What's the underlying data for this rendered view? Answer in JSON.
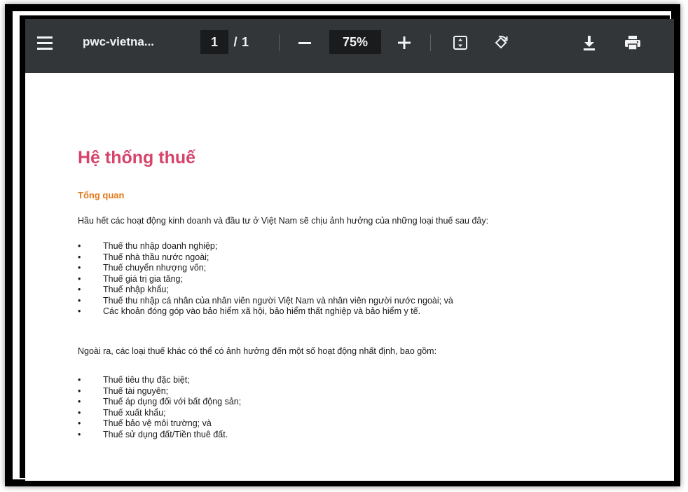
{
  "toolbar": {
    "file_name": "pwc-vietna...",
    "page_current": "1",
    "page_separator": "/",
    "page_total": "1",
    "zoom": "75%",
    "icons": [
      "menu-icon",
      "zoom-out-icon",
      "zoom-in-icon",
      "fit-page-icon",
      "rotate-icon",
      "download-icon",
      "print-icon"
    ]
  },
  "document": {
    "title": "Hệ thống thuế",
    "subtitle": "Tổng quan",
    "intro": "Hầu hết các hoạt động kinh doanh và đầu tư ở Việt Nam sẽ chịu ảnh hưởng của những loại thuế sau đây:",
    "main_taxes": [
      "Thuế thu nhập doanh nghiệp;",
      "Thuế nhà thầu nước ngoài;",
      "Thuế chuyển nhượng vốn;",
      "Thuế giá trị gia tăng;",
      "Thuế nhập khẩu;",
      "Thuế thu nhập cá nhân của nhân viên người Việt Nam và nhân viên người nước ngoài; và",
      "Các khoản đóng góp vào bảo hiểm xã hội, bảo hiểm thất nghiệp và bảo hiểm y tế."
    ],
    "other_intro": "Ngoài ra, các loại thuế khác có thể có ảnh hưởng đến một số hoạt động nhất định, bao gồm:",
    "other_taxes": [
      "Thuế tiêu thụ đặc biệt;",
      "Thuế tài nguyên;",
      "Thuế áp dụng đối với bất động sản;",
      "Thuế xuất khẩu;",
      "Thuế bảo vệ môi trường; và",
      "Thuế sử dụng đất/Tiền thuê đất."
    ]
  },
  "colors": {
    "toolbar_bg": "#323639",
    "title": "#d6446a",
    "subtitle": "#e47a1c"
  }
}
